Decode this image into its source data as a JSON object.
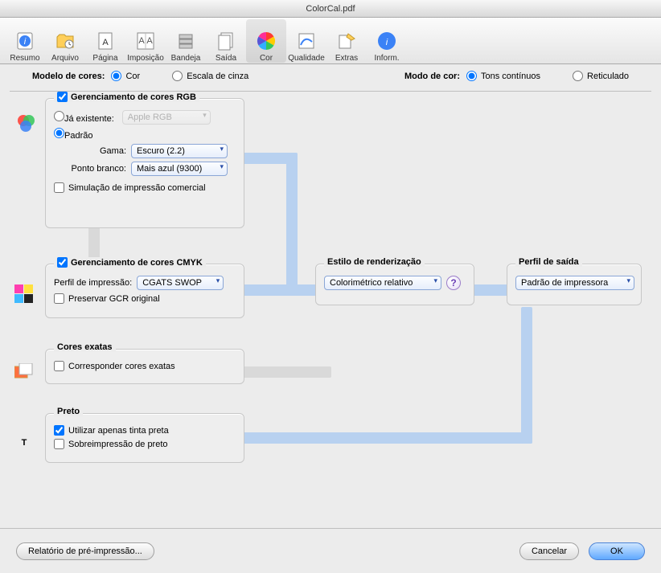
{
  "window": {
    "title": "ColorCal.pdf"
  },
  "toolbar": {
    "items": [
      {
        "label": "Resumo"
      },
      {
        "label": "Arquivo"
      },
      {
        "label": "Página"
      },
      {
        "label": "Imposição"
      },
      {
        "label": "Bandeja"
      },
      {
        "label": "Saída"
      },
      {
        "label": "Cor"
      },
      {
        "label": "Qualidade"
      },
      {
        "label": "Extras"
      },
      {
        "label": "Inform."
      }
    ],
    "selected_index": 6
  },
  "modebar": {
    "model_label": "Modelo de cores:",
    "model_options": {
      "color": "Cor",
      "gray": "Escala de cinza"
    },
    "model_selected": "color",
    "mode_label": "Modo de cor:",
    "mode_options": {
      "continuous": "Tons contínuos",
      "halftone": "Reticulado"
    },
    "mode_selected": "continuous"
  },
  "rgb_panel": {
    "title": "Gerenciamento de cores RGB",
    "enabled": true,
    "existing_label": "Já existente:",
    "existing_value": "Apple RGB",
    "default_label": "Padrão",
    "source_selected": "default",
    "gamma_label": "Gama:",
    "gamma_value": "Escuro (2.2)",
    "whitepoint_label": "Ponto branco:",
    "whitepoint_value": "Mais azul (9300)",
    "sim_label": "Simulação de impressão comercial",
    "sim_checked": false
  },
  "cmyk_panel": {
    "title": "Gerenciamento de cores CMYK",
    "enabled": true,
    "profile_label": "Perfil de impressão:",
    "profile_value": "CGATS SWOP",
    "gcr_label": "Preservar GCR original",
    "gcr_checked": false
  },
  "render_panel": {
    "title": "Estilo de renderização",
    "value": "Colorimétrico relativo",
    "help": "?"
  },
  "output_panel": {
    "title": "Perfil de saída",
    "value": "Padrão de impressora"
  },
  "spot_panel": {
    "title": "Cores exatas",
    "match_label": "Corresponder cores exatas",
    "match_checked": false
  },
  "black_panel": {
    "title": "Preto",
    "inkonly_label": "Utilizar apenas tinta preta",
    "inkonly_checked": true,
    "overprint_label": "Sobreimpressão de preto",
    "overprint_checked": false
  },
  "footer": {
    "report": "Relatório de pré-impressão...",
    "cancel": "Cancelar",
    "ok": "OK"
  }
}
